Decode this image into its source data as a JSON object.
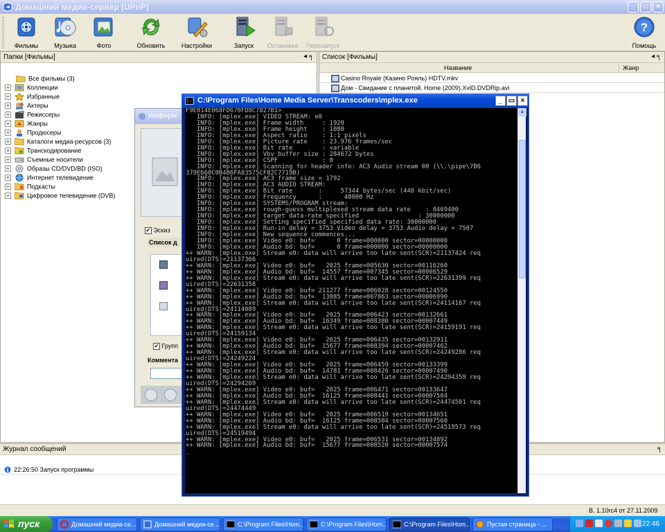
{
  "main_window": {
    "title": "Домашний медиа-сервер (UPnP)",
    "minimize_label": "_",
    "maximize_label": "□",
    "close_label": "×"
  },
  "toolbar": {
    "films": "Фильмы",
    "music": "Музыка",
    "photo": "Фото",
    "refresh": "Обновить",
    "settings": "Настройки",
    "start": "Запуск",
    "stop": "Остановка",
    "restart": "Перезапуск",
    "help": "Помощь"
  },
  "folders_panel": {
    "title": "Папки [Фильмы]",
    "pin": "◂ ╕",
    "items": [
      "Все фильмы (3)",
      "Коллекции",
      "Избранные",
      "Актеры",
      "Режиссеры",
      "Жанры",
      "Продюсеры",
      "Каталоги медиа-ресурсов (3)",
      "Транскодирование",
      "Съемные носители",
      "Образы CD/DVD/BD (ISO)",
      "Интернет телевидение",
      "Подкасты",
      "Цифровое телевидение (DVB)"
    ]
  },
  "list_panel": {
    "title": "Список [Фильмы]",
    "pin": "◂ ╕",
    "col_name": "Название",
    "col_genre": "Жанр",
    "rows": [
      "Casino Royale (Казино Рояль) HDTV.mkv",
      "Дом - Свидание с планетой. Home (2009).XviD.DVDRip.avi"
    ]
  },
  "info_dialog": {
    "title": "Информ",
    "sketch_label": "Эскиз",
    "list_label": "Список д",
    "group_label": "Групп",
    "comment_label": "Коммента"
  },
  "log_panel": {
    "title": "Журнал сообщений",
    "pin": "╕",
    "entry": "22:26:50 Запуск программы"
  },
  "status_bar": {
    "version": "В. 1.10rc4 от 27.11.2009"
  },
  "console": {
    "title": "C:\\Program Files\\Home Media Server\\Transcoders\\mplex.exe",
    "icon_text": "C:\\",
    "lines": [
      "F9E014E068FD670FD8C7827B1>",
      "   INFO: [mplex.exe] VIDEO STREAM: e0",
      "   INFO: [mplex.exe] Frame width     : 1920",
      "   INFO: [mplex.exe] Frame height    : 1080",
      "   INFO: [mplex.exe] Aspect ratio    : 1:1 pixels",
      "   INFO: [mplex.exe] Picture rate    : 23.976 frames/sec",
      "   INFO: [mplex.exe] Bit rate        : variable",
      "   INFO: [mplex.exe] Vbv buffer size : 284672 bytes",
      "   INFO: [mplex.exe] CSPF            : 0",
      "   INFO: [mplex.exe] Scanning for header info: AC3 Audio stream 00 (\\\\.\\pipe\\7B6",
      "379E660C0B4B6FA83575CF82C7719B)",
      "   INFO: [mplex.exe] AC3 frame size = 1792",
      "   INFO: [mplex.exe] AC3 AUDIO STREAM:",
      "   INFO: [mplex.exe] Bit rate       :     57344 bytes/sec (448 kbit/sec)",
      "   INFO: [mplex.exe] Frequency      :      48000 Hz",
      "   INFO: [mplex.exe] SYSTEMS/PROGRAM stream:",
      "   INFO: [mplex.exe] rough-guess multiplexed stream data rate    : 0469400",
      "   INFO: [mplex.exe] target data-rate specified                : 30000000",
      "   INFO: [mplex.exe] Setting specified specified data rate: 30000000",
      "   INFO: [mplex.exe] Run-in delay = 3753 Video delay = 3753 Audio delay = 7507",
      "   INFO: [mplex.exe] New sequence commences...",
      "   INFO: [mplex.exe] Video e0: buf=      0 frame=000000 sector=00000000",
      "   INFO: [mplex.exe] Audio bd: buf=      0 frame=000000 sector=00000000",
      "++ WARN: [mplex.exe] Stream e0: data will arrive too late sent(SCR)=21137424 req",
      "uired(DTS)=21137366",
      "++ WARN: [mplex.exe] Video e0: buf=   2025 frame=005630 sector=00116260",
      "++ WARN: [mplex.exe] Audio bd: buf=  14557 frame=007345 sector=00006529",
      "++ WARN: [mplex.exe] Stream e0: data will arrive too late sent(SCR)=22631399 req",
      "uired(DTS)=22631358",
      "++ WARN: [mplex.exe] Video e0: buf= 211277 frame=006028 sector=00124550",
      "++ WARN: [mplex.exe] Audio bd: buf=  13885 frame=007863 sector=00006990",
      "++ WARN: [mplex.exe] Stream e0: data will arrive too late sent(SCR)=24114167 req",
      "uired(DTS)=24114089",
      "++ WARN: [mplex.exe] Video e0: buf=   2025 frame=006423 sector=00132661",
      "++ WARN: [mplex.exe] Audio bd: buf=  16349 frame=008380 sector=00007449",
      "++ WARN: [mplex.exe] Stream e0: data will arrive too late sent(SCR)=24159191 req",
      "uired(DTS)=24159134",
      "++ WARN: [mplex.exe] Video e0: buf=   2025 frame=006435 sector=00132911",
      "++ WARN: [mplex.exe] Audio bd: buf=  15677 frame=008394 sector=00007462",
      "++ WARN: [mplex.exe] Stream e0: data will arrive too late sent(SCR)=24249286 req",
      "uired(DTS)=24249224",
      "++ WARN: [mplex.exe] Video e0: buf=   2025 frame=006459 sector=00133399",
      "++ WARN: [mplex.exe] Audio bd: buf=  14781 frame=008426 sector=00007490",
      "++ WARN: [mplex.exe] Stream e0: data will arrive too late sent(SCR)=24294359 req",
      "uired(DTS)=24294269",
      "++ WARN: [mplex.exe] Video e0: buf=   2025 frame=006471 sector=00133647",
      "++ WARN: [mplex.exe] Audio bd: buf=  16125 frame=008441 sector=00007504",
      "++ WARN: [mplex.exe] Stream e0: data will arrive too late sent(SCR)=24474501 req",
      "uired(DTS)=24474449",
      "++ WARN: [mplex.exe] Video e0: buf=   2025 frame=006519 sector=00134651",
      "++ WARN: [mplex.exe] Audio bd: buf=  16125 frame=008504 sector=00007560",
      "++ WARN: [mplex.exe] Stream e0: data will arrive too late sent(SCR)=24519573 req",
      "uired(DTS)=24519494",
      "++ WARN: [mplex.exe] Video e0: buf=   2025 frame=006531 sector=00134892",
      "++ WARN: [mplex.exe] Audio bd: buf=  15677 frame=008520 sector=00007574",
      "_"
    ]
  },
  "taskbar": {
    "start_label": "пуск",
    "tasks": [
      "Домашний медиа-се...",
      "Домашний медиа-се...",
      "C:\\Program Files\\Hom...",
      "C:\\Program Files\\Hom...",
      "C:\\Program Files\\Hom...",
      "Пустая страница - ..."
    ],
    "clock": "22:46"
  },
  "colors": {
    "xp_blue": "#0a4ed8",
    "desktop_face": "#ece9d8",
    "console_text": "#c0c0c0",
    "start_green": "#3a9a3a"
  }
}
